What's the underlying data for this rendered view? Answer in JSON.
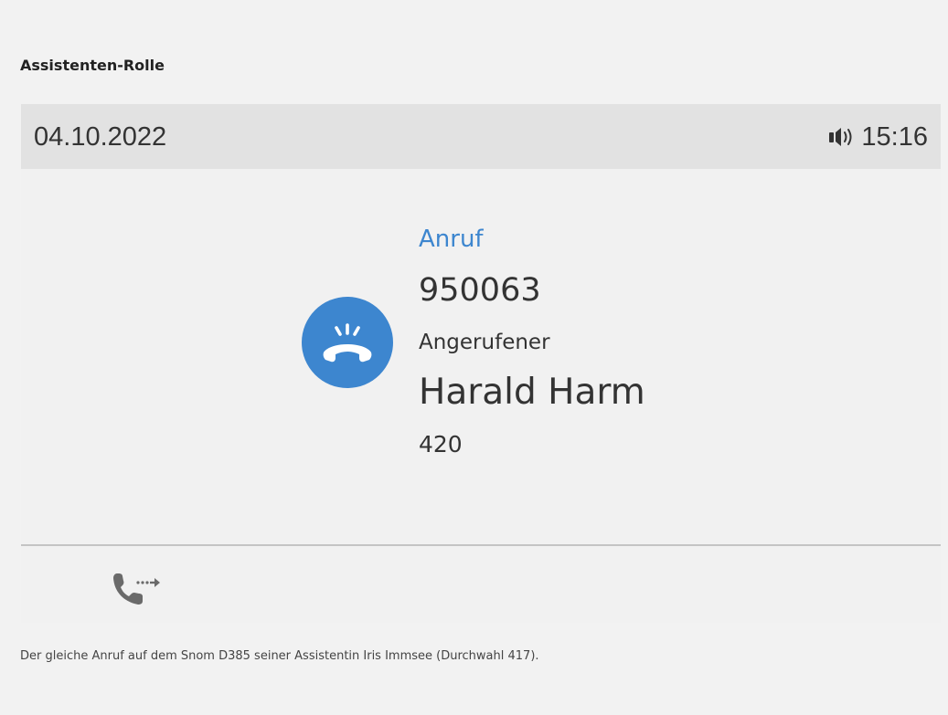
{
  "section_title": "Assistenten-Rolle",
  "phone": {
    "status_bar": {
      "date": "04.10.2022",
      "time": "15:16",
      "audio_icon": "speaker-icon"
    },
    "call": {
      "icon": "incoming-call-icon",
      "type_label": "Anruf",
      "caller_number": "950063",
      "callee_label": "Angerufener",
      "callee_name": "Harald Harm",
      "callee_extension": "420"
    },
    "softkeys": [
      {
        "icon": "call-transfer-icon"
      }
    ],
    "colors": {
      "accent": "#3d86cf",
      "status_bar_bg": "#e2e2e2",
      "screen_bg": "#f1f1f1",
      "icon_gray": "#6a6a6a"
    }
  },
  "caption": "Der gleiche Anruf auf dem Snom D385 seiner Assistentin Iris Immsee (Durchwahl 417)."
}
